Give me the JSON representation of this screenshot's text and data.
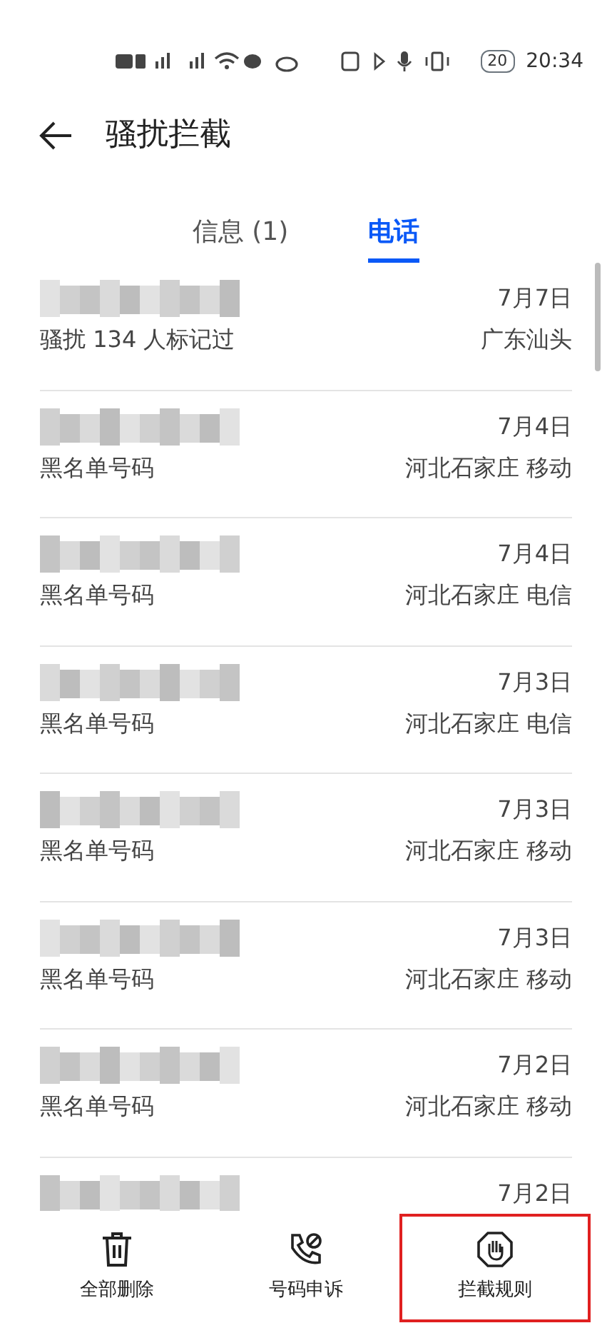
{
  "status_bar": {
    "battery": "20",
    "time": "20:34"
  },
  "header": {
    "title": "骚扰拦截"
  },
  "tabs": [
    {
      "label": "信息 (1)",
      "selected": false
    },
    {
      "label": "电话",
      "selected": true
    }
  ],
  "calls": [
    {
      "date": "7月7日",
      "tag": "骚扰  134 人标记过",
      "location": "广东汕头"
    },
    {
      "date": "7月4日",
      "tag": "黑名单号码",
      "location": "河北石家庄 移动"
    },
    {
      "date": "7月4日",
      "tag": "黑名单号码",
      "location": "河北石家庄 电信"
    },
    {
      "date": "7月3日",
      "tag": "黑名单号码",
      "location": "河北石家庄 电信"
    },
    {
      "date": "7月3日",
      "tag": "黑名单号码",
      "location": "河北石家庄 移动"
    },
    {
      "date": "7月3日",
      "tag": "黑名单号码",
      "location": "河北石家庄 移动"
    },
    {
      "date": "7月2日",
      "tag": "黑名单号码",
      "location": "河北石家庄 移动"
    },
    {
      "date": "7月2日"
    }
  ],
  "bottom_bar": [
    {
      "kind": "delete",
      "label": "全部删除",
      "highlighted": false
    },
    {
      "kind": "appeal",
      "label": "号码申诉",
      "highlighted": false
    },
    {
      "kind": "rules",
      "label": "拦截规则",
      "highlighted": true
    }
  ]
}
